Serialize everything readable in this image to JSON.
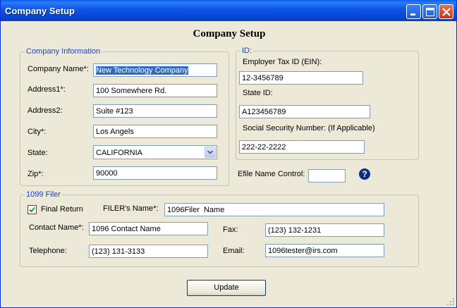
{
  "window": {
    "title": "Company Setup"
  },
  "heading": "Company Setup",
  "company_info": {
    "legend": "Company Information",
    "company_name": {
      "label": "Company Name*:",
      "value": "New Technology Company"
    },
    "address1": {
      "label": "Address1*:",
      "value": "100 Somewhere Rd."
    },
    "address2": {
      "label": "Address2:",
      "value": "Suite #123"
    },
    "city": {
      "label": "City*:",
      "value": "Los Angels"
    },
    "state": {
      "label": "State:",
      "value": "CALIFORNIA"
    },
    "zip": {
      "label": "Zip*:",
      "value": "90000"
    }
  },
  "id_group": {
    "legend": "ID:",
    "ein": {
      "label": "Employer Tax ID (EIN):",
      "value": "12-3456789"
    },
    "state_id": {
      "label": "State ID:",
      "value": "A123456789"
    },
    "ssn": {
      "label": "Social Security Number: (If Applicable)",
      "value": "222-22-2222"
    }
  },
  "efile": {
    "label": "Efile Name Control:",
    "value": "",
    "help_glyph": "?"
  },
  "filer": {
    "legend": "1099 Filer",
    "final_return": {
      "label": "Final Return",
      "checked": true
    },
    "filer_name": {
      "label": "FILER's Name*:",
      "value": "1096Filer  Name"
    },
    "contact_name": {
      "label": "Contact Name*:",
      "value": "1096 Contact Name"
    },
    "fax": {
      "label": "Fax:",
      "value": "(123) 132-1231"
    },
    "telephone": {
      "label": "Telephone:",
      "value": "(123) 131-3133"
    },
    "email": {
      "label": "Email:",
      "value": "1096tester@irs.com"
    }
  },
  "update_button": "Update"
}
